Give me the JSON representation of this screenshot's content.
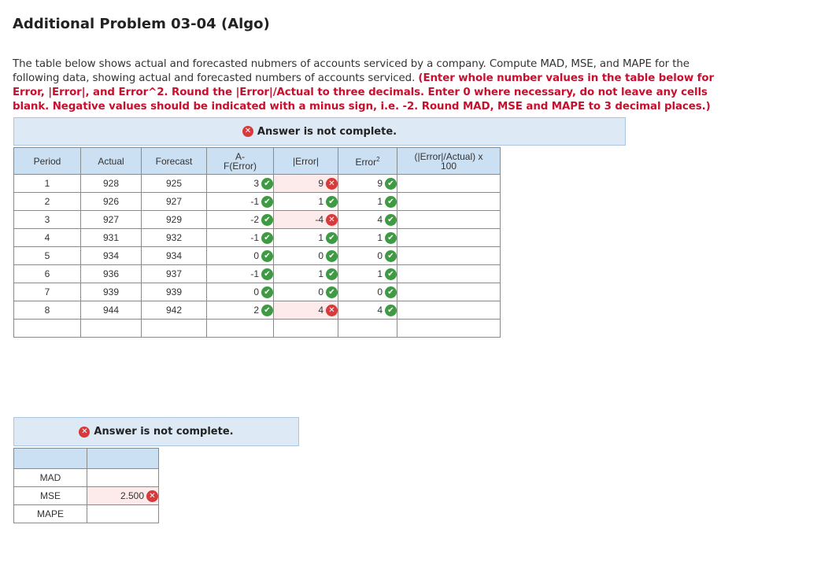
{
  "title": "Additional Problem 03-04 (Algo)",
  "instructions": {
    "plain": "The table below shows actual and forecasted nubmers of accounts serviced by a company. Compute MAD, MSE, and MAPE for the following data, showing actual and forecasted numbers of accounts serviced.",
    "bold_red": "(Enter whole number values in the table below for Error, |Error|, and Error^2. Round the |Error|/Actual to three decimals. Enter 0 where necessary, do not leave any cells blank. Negative values should be indicated with a minus sign, i.e. -2. Round MAD, MSE and MAPE to 3 decimal places.)"
  },
  "banner1": "Answer is not complete.",
  "banner2": "Answer is not complete.",
  "table": {
    "headers": {
      "period": "Period",
      "actual": "Actual",
      "forecast": "Forecast",
      "error_line1": "A-",
      "error_line2": "F(Error)",
      "abs_error": "|Error|",
      "error_sq": "Error",
      "error_sq_sup": "2",
      "pct_line1": "(|Error|/Actual) x",
      "pct_line2": "100"
    },
    "rows": [
      {
        "period": "1",
        "actual": "928",
        "forecast": "925",
        "error": "3",
        "error_ok": true,
        "abs": "9",
        "abs_ok": false,
        "sq": "9",
        "sq_ok": true
      },
      {
        "period": "2",
        "actual": "926",
        "forecast": "927",
        "error": "-1",
        "error_ok": true,
        "abs": "1",
        "abs_ok": true,
        "sq": "1",
        "sq_ok": true
      },
      {
        "period": "3",
        "actual": "927",
        "forecast": "929",
        "error": "-2",
        "error_ok": true,
        "abs": "-4",
        "abs_ok": false,
        "sq": "4",
        "sq_ok": true
      },
      {
        "period": "4",
        "actual": "931",
        "forecast": "932",
        "error": "-1",
        "error_ok": true,
        "abs": "1",
        "abs_ok": true,
        "sq": "1",
        "sq_ok": true
      },
      {
        "period": "5",
        "actual": "934",
        "forecast": "934",
        "error": "0",
        "error_ok": true,
        "abs": "0",
        "abs_ok": true,
        "sq": "0",
        "sq_ok": true
      },
      {
        "period": "6",
        "actual": "936",
        "forecast": "937",
        "error": "-1",
        "error_ok": true,
        "abs": "1",
        "abs_ok": true,
        "sq": "1",
        "sq_ok": true
      },
      {
        "period": "7",
        "actual": "939",
        "forecast": "939",
        "error": "0",
        "error_ok": true,
        "abs": "0",
        "abs_ok": true,
        "sq": "0",
        "sq_ok": true
      },
      {
        "period": "8",
        "actual": "944",
        "forecast": "942",
        "error": "2",
        "error_ok": true,
        "abs": "4",
        "abs_ok": false,
        "sq": "4",
        "sq_ok": true
      }
    ]
  },
  "summary": {
    "rows": [
      {
        "label": "MAD",
        "value": "",
        "status": "none"
      },
      {
        "label": "MSE",
        "value": "2.500",
        "status": "wrong"
      },
      {
        "label": "MAPE",
        "value": "",
        "status": "none"
      }
    ]
  },
  "colors": {
    "correct": "#3f9a44",
    "incorrect": "#d63a3a",
    "header_bg": "#cce0f3",
    "banner_bg": "#ddeaf6",
    "wrong_cell_bg": "#fdeaea"
  }
}
